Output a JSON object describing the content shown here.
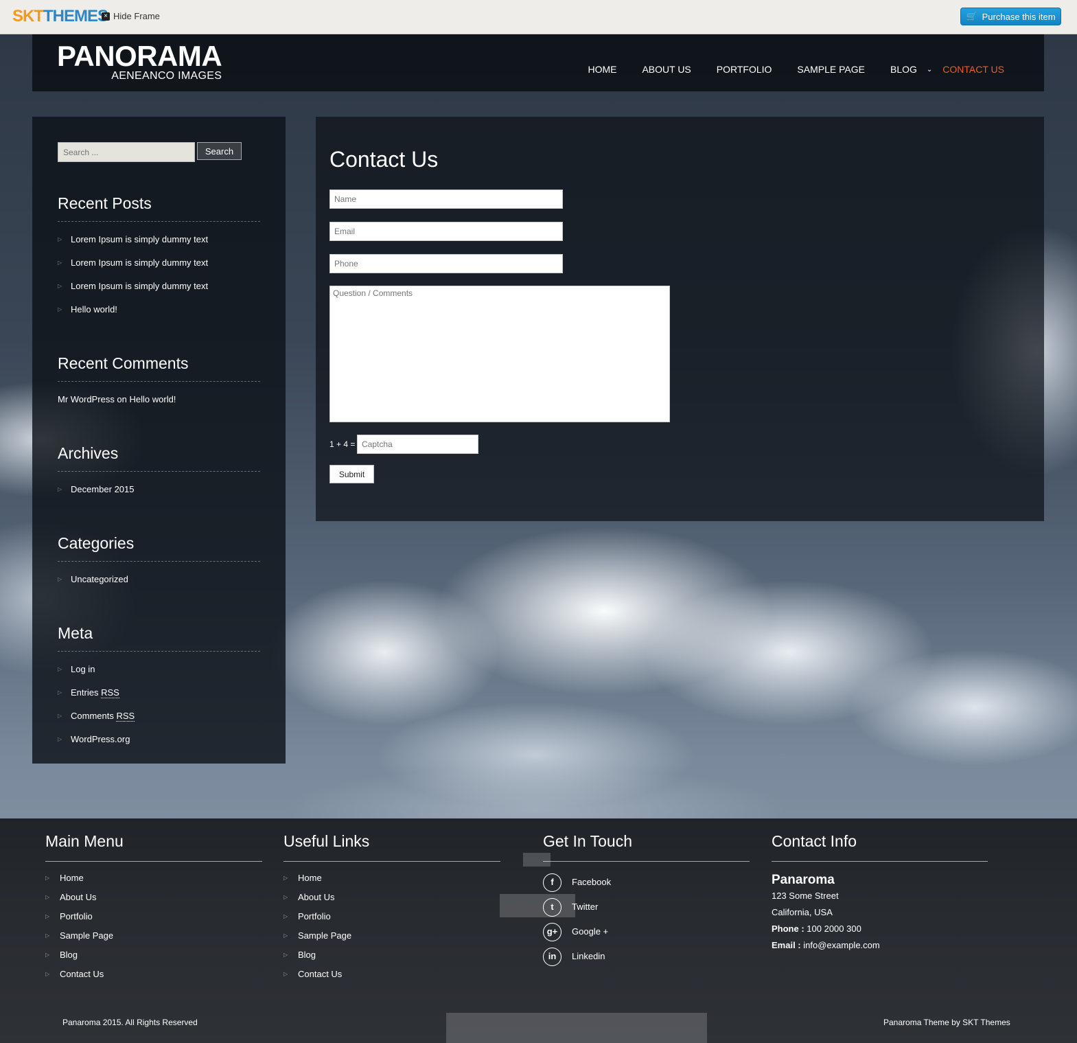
{
  "topbar": {
    "logo_a": "SKT",
    "logo_b": "THEMES",
    "hide_frame": "Hide Frame",
    "purchase": "Purchase this item"
  },
  "site": {
    "name": "PANORAMA",
    "tagline": "AENEANCO IMAGES"
  },
  "nav": {
    "items": [
      "HOME",
      "ABOUT US",
      "PORTFOLIO",
      "SAMPLE PAGE",
      "BLOG",
      "CONTACT US"
    ],
    "active": "CONTACT US"
  },
  "sidebar": {
    "search_placeholder": "Search ...",
    "search_button": "Search",
    "recent_posts": {
      "title": "Recent Posts",
      "items": [
        "Lorem Ipsum is simply dummy text",
        "Lorem Ipsum is simply dummy text",
        "Lorem Ipsum is simply dummy text",
        "Hello world!"
      ]
    },
    "recent_comments": {
      "title": "Recent Comments",
      "text": "Mr WordPress on Hello world!"
    },
    "archives": {
      "title": "Archives",
      "items": [
        "December 2015"
      ]
    },
    "categories": {
      "title": "Categories",
      "items": [
        "Uncategorized"
      ]
    },
    "meta": {
      "title": "Meta",
      "items": [
        "Log in",
        "Entries RSS",
        "Comments RSS",
        "WordPress.org"
      ]
    }
  },
  "contact": {
    "title": "Contact Us",
    "name_placeholder": "Name",
    "email_placeholder": "Email",
    "phone_placeholder": "Phone",
    "comments_placeholder": "Question / Comments",
    "captcha_label": "1 + 4 =",
    "captcha_placeholder": "Captcha",
    "submit": "Submit"
  },
  "footer": {
    "main_menu": {
      "title": "Main Menu",
      "items": [
        "Home",
        "About Us",
        "Portfolio",
        "Sample Page",
        "Blog",
        "Contact Us"
      ]
    },
    "useful_links": {
      "title": "Useful Links",
      "items": [
        "Home",
        "About Us",
        "Portfolio",
        "Sample Page",
        "Blog",
        "Contact Us"
      ]
    },
    "get_in_touch": {
      "title": "Get In Touch",
      "items": [
        {
          "label": "Facebook",
          "icon": "facebook-icon",
          "glyph": "f"
        },
        {
          "label": "Twitter",
          "icon": "twitter-icon",
          "glyph": "t"
        },
        {
          "label": "Google +",
          "icon": "google-plus-icon",
          "glyph": "g+"
        },
        {
          "label": "Linkedin",
          "icon": "linkedin-icon",
          "glyph": "in"
        }
      ]
    },
    "contact_info": {
      "title": "Contact Info",
      "name": "Panaroma",
      "address1": "123 Some Street",
      "address2": "California, USA",
      "phone_label": "Phone :",
      "phone": "100 2000 300",
      "email_label": "Email :",
      "email": "info@example.com"
    },
    "copyright": "Panaroma 2015. All Rights Reserved",
    "credit": "Panaroma Theme by SKT Themes"
  },
  "colors": {
    "accent": "#f15a24",
    "purchase_button": "#1a93d4",
    "panel": "#0e1218"
  }
}
